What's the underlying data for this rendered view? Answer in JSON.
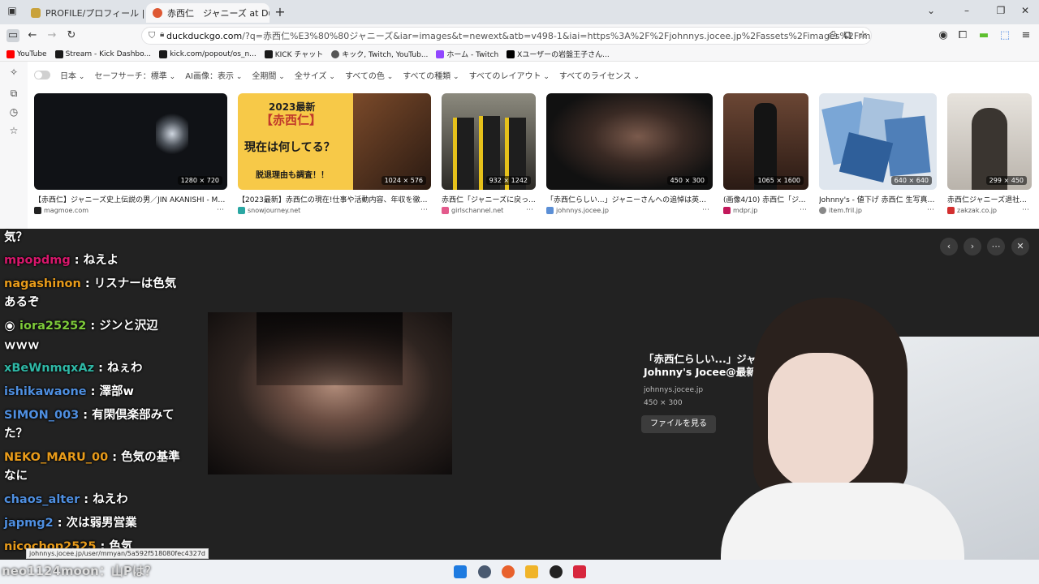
{
  "tabs": [
    {
      "label": "PROFILE/プロフィール | 嵐 | Storm",
      "favicon_color": "#c9a23b"
    },
    {
      "label": "赤西仁　ジャニーズ at DuckDuckGo",
      "favicon_color": "#de5833"
    }
  ],
  "new_tab_icon": "plus-icon",
  "window_controls": [
    "chevron-down-icon",
    "minimize-icon",
    "restore-icon",
    "close-icon"
  ],
  "url": {
    "domain": "duckduckgo.com",
    "rest": "/?q=赤西仁%E3%80%80ジャニーズ&iar=images&t=newext&atb=v498-1&iai=https%3A%2F%2Fjohnnys.jocee.jp%2Fassets%2Fimages%2Frmatome%2F5a592f518080fec4327d%2F5f...."
  },
  "bookmarks": [
    {
      "label": "YouTube",
      "color": "#ff0000"
    },
    {
      "label": "Stream - Kick Dashbo...",
      "color": "#1a1a1a"
    },
    {
      "label": "kick.com/popout/os_n...",
      "color": "#1a1a1a"
    },
    {
      "label": "KICK チャット",
      "color": "#1a1a1a"
    },
    {
      "label": "キック, Twitch, YouTub...",
      "color": "#555555"
    },
    {
      "label": "ホーム - Twitch",
      "color": "#9146ff"
    },
    {
      "label": "Xユーザーの岩盤王子さん...",
      "color": "#000000"
    }
  ],
  "filters": [
    "日本",
    "セーフサーチ：標準",
    "AI画像：表示",
    "全期間",
    "全サイズ",
    "すべての色",
    "すべての種類",
    "すべてのレイアウト",
    "すべてのライセンス"
  ],
  "results": [
    {
      "title": "【赤西仁】ジャニーズ史上伝説の男／JIN AKANISHI - MA...",
      "source": "magmoe.com",
      "dims": "1280 × 720",
      "color": "#101216",
      "src_color": "#222"
    },
    {
      "title": "【2023最新】赤西仁の現在!仕事や活動内容、年収を徹底...",
      "source": "snowjourney.net",
      "dims": "1024 × 576",
      "color": "#f2c94c",
      "src_color": "#2aa7a3",
      "overlay_line1": "2023最新",
      "overlay_line2": "【赤西仁】",
      "overlay_line3": "現在は何してる？",
      "overlay_line4": "脱退理由も調査！！"
    },
    {
      "title": "赤西仁「ジャニーズに戻っ...",
      "source": "girlschannel.net",
      "dims": "932 × 1242",
      "color": "#4a4a3c",
      "src_color": "#e35a8c"
    },
    {
      "title": "「赤西仁らしい...」ジャニーさんへの追悼は英語...",
      "source": "johnnys.jocee.jp",
      "dims": "450 × 300",
      "color": "#1a1514",
      "src_color": "#5b8fd6"
    },
    {
      "title": "(画像4/10) 赤西仁「ジャ...",
      "source": "mdpr.jp",
      "dims": "1065 × 1600",
      "color": "#3a2a22",
      "src_color": "#c2185b"
    },
    {
      "title": "Johnny's - 値下げ 赤西仁 生写真 公...",
      "source": "item.fril.jp",
      "dims": "640 × 640",
      "color": "#9ab7d3",
      "src_color": "#888"
    },
    {
      "title": "赤西仁ジャニーズ退社...",
      "source": "zakzak.co.jp",
      "dims": "299 × 450",
      "color": "#c8c4be",
      "src_color": "#d32f2f"
    }
  ],
  "viewer": {
    "title": "「赤西仁らしい...」ジャニーさんへの追悼は英語でこの楽曲「Johnny」| Johnny's Jocee@最新ニュース",
    "domain": "johnnys.jocee.jp",
    "size": "450 × 300",
    "view_file": "ファイルを見る"
  },
  "chat": [
    {
      "user": "",
      "msg": "気？",
      "color": "#ffffff",
      "cont": ""
    },
    {
      "user": "mpopdmg",
      "msg": "ねえよ",
      "color": "#d6176b",
      "cont": ""
    },
    {
      "user": "nagashinon",
      "msg": "リスナーは色気",
      "color": "#e89b1a",
      "cont": "あるぞ"
    },
    {
      "user": "iora25252",
      "msg": "ジンと沢辺",
      "color": "#7ecb3a",
      "cont": "ｗｗｗ"
    },
    {
      "user": "xBeWnmqxAz",
      "msg": "ねぇわ",
      "color": "#2fb8a6",
      "cont": ""
    },
    {
      "user": "ishikawaone",
      "msg": "澤部w",
      "color": "#4f8fe0",
      "cont": ""
    },
    {
      "user": "SIMON_003",
      "msg": "有閑倶楽部みて",
      "color": "#4f8fe0",
      "cont": "た？"
    },
    {
      "user": "NEKO_MARU_00",
      "msg": "色気の基準",
      "color": "#e89b1a",
      "cont": "なに"
    },
    {
      "user": "chaos_alter",
      "msg": "ねえわ",
      "color": "#4f8fe0",
      "cont": ""
    },
    {
      "user": "japmg2",
      "msg": "次は弱男営業",
      "color": "#4f8fe0",
      "cont": ""
    },
    {
      "user": "nicochop2525",
      "msg": "色気",
      "color": "#e89b1a",
      "cont": ""
    }
  ],
  "status_url": "johnnys.jocee.jp/user/mmyan/5a592f518080fec4327d",
  "bottom_chat": "neo1124moon：山Pは？",
  "taskbar_icons": [
    {
      "name": "windows-start-icon",
      "color": "#1e7be0"
    },
    {
      "name": "settings-gear-icon",
      "color": "#4a5a70"
    },
    {
      "name": "firefox-icon",
      "color": "#e8612c"
    },
    {
      "name": "file-explorer-icon",
      "color": "#f0b429"
    },
    {
      "name": "obs-icon",
      "color": "#222222"
    },
    {
      "name": "app-icon",
      "color": "#d7263d"
    }
  ]
}
